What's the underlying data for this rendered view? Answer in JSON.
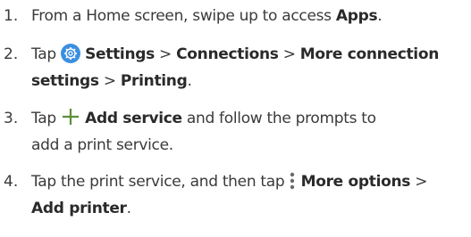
{
  "steps": [
    {
      "number": "1.",
      "lines": [
        {
          "pre": "From a Home screen, swipe up to access ",
          "bold": "Apps",
          "post": "."
        }
      ]
    },
    {
      "number": "2.",
      "line1": {
        "pre": "Tap ",
        "bold": "Settings",
        "sep1": " > ",
        "bold2": "Connections",
        "sep2": " > ",
        "bold3": "More connection"
      },
      "line2": {
        "bold": "settings",
        "sep": " > ",
        "bold2": "Printing",
        "post": "."
      }
    },
    {
      "number": "3.",
      "line1": {
        "pre": "Tap ",
        "bold": "Add service",
        "post": " and follow the prompts to"
      },
      "line2": {
        "text": "add a print service."
      }
    },
    {
      "number": "4.",
      "line1": {
        "pre": "Tap the print service, and then tap ",
        "bold": "More options",
        "post": " >"
      },
      "line2": {
        "bold": "Add printer",
        "post": "."
      }
    }
  ],
  "icons": {
    "settings": "settings-gear-icon",
    "add": "plus-icon",
    "more": "more-options-icon"
  },
  "colors": {
    "settings_icon": "#3b8fe0",
    "add_icon": "#5a8f3a"
  }
}
